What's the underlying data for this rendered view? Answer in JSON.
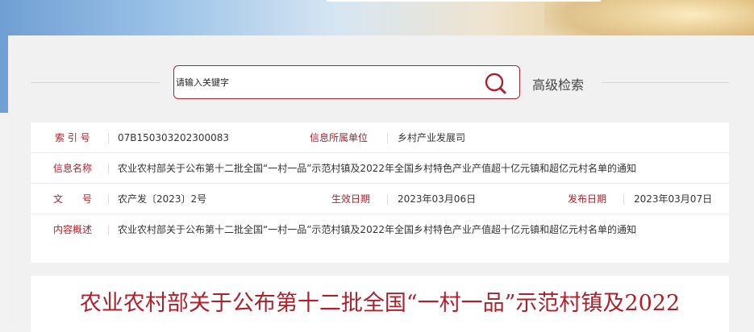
{
  "search": {
    "placeholder": "请输入关键字",
    "advanced_label": "高级检索"
  },
  "info": {
    "index_label": "索 引 号",
    "index_value": "07B150303202300083",
    "unit_label": "信息所属单位",
    "unit_value": "乡村产业发展司",
    "name_label": "信息名称",
    "name_value": "农业农村部关于公布第十二批全国“一村一品”示范村镇及2022年全国乡村特色产业产值超十亿元镇和超亿元村名单的通知",
    "docno_label": "文　　号",
    "docno_value": "农产发〔2023〕2号",
    "effective_label": "生效日期",
    "effective_value": "2023年03月06日",
    "publish_label": "发布日期",
    "publish_value": "2023年03月07日",
    "summary_label": "内容概述",
    "summary_value": "农业农村部关于公布第十二批全国“一村一品”示范村镇及2022年全国乡村特色产业产值超十亿元镇和超亿元村名单的通知"
  },
  "document": {
    "title": "农业农村部关于公布第十二批全国“一村一品”示范村镇及2022"
  },
  "colors": {
    "accent": "#b0202a",
    "panel": "#f1f1f1"
  },
  "icons": {
    "search": "search-icon"
  }
}
